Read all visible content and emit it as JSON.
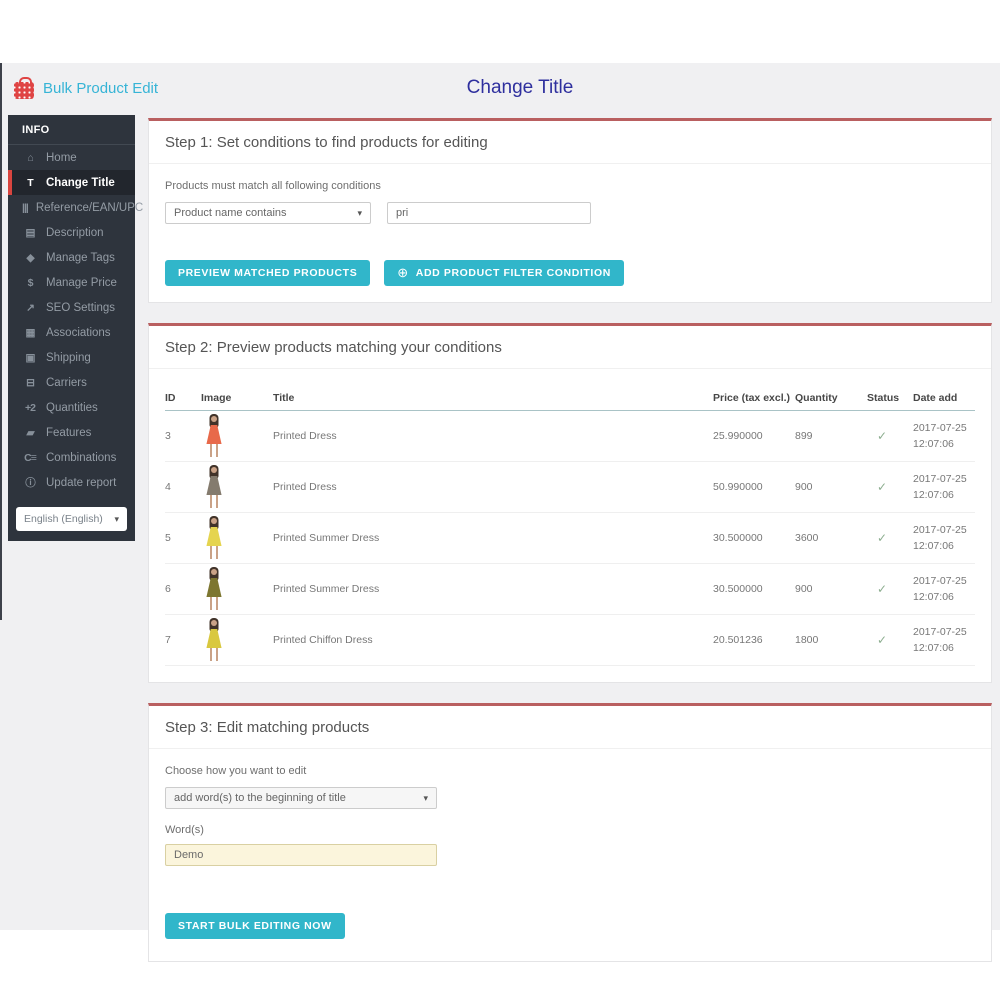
{
  "header": {
    "app_title": "Bulk Product Edit",
    "page_title": "Change Title"
  },
  "icons": {
    "caret": "▾",
    "plus": "⊕"
  },
  "sidebar": {
    "section_label": "INFO",
    "items": [
      {
        "label": "Home",
        "glyph": "⌂",
        "icon": "home-icon"
      },
      {
        "label": "Change Title",
        "glyph": "T",
        "icon": "title-icon"
      },
      {
        "label": "Reference/EAN/UPC",
        "glyph": "|||",
        "icon": "barcode-icon"
      },
      {
        "label": "Description",
        "glyph": "▤",
        "icon": "document-icon"
      },
      {
        "label": "Manage Tags",
        "glyph": "◆",
        "icon": "tag-icon"
      },
      {
        "label": "Manage Price",
        "glyph": "$",
        "icon": "dollar-icon"
      },
      {
        "label": "SEO Settings",
        "glyph": "↗",
        "icon": "trend-icon"
      },
      {
        "label": "Associations",
        "glyph": "▦",
        "icon": "grid-icon"
      },
      {
        "label": "Shipping",
        "glyph": "▣",
        "icon": "package-icon"
      },
      {
        "label": "Carriers",
        "glyph": "⊟",
        "icon": "truck-icon"
      },
      {
        "label": "Quantities",
        "glyph": "+2",
        "icon": "quantities-icon"
      },
      {
        "label": "Features",
        "glyph": "▰",
        "icon": "features-icon"
      },
      {
        "label": "Combinations",
        "glyph": "C≡",
        "icon": "combinations-icon"
      },
      {
        "label": "Update report",
        "glyph": "ⓘ",
        "icon": "report-icon"
      }
    ],
    "language_select": {
      "value": "English (English)"
    }
  },
  "step1": {
    "title": "Step 1: Set conditions to find products for editing",
    "condition_label": "Products must match all following conditions",
    "condition_select": "Product name contains",
    "condition_value": "pri",
    "preview_button": "PREVIEW MATCHED PRODUCTS",
    "add_filter_button": "ADD PRODUCT FILTER CONDITION"
  },
  "step2": {
    "title": "Step 2: Preview products matching your conditions",
    "columns": [
      "ID",
      "Image",
      "Title",
      "Price (tax excl.)",
      "Quantity",
      "Status",
      "Date add"
    ],
    "rows": [
      {
        "id": "3",
        "title": "Printed Dress",
        "price": "25.990000",
        "quantity": "899",
        "status": "✓",
        "date": "2017-07-25 12:07:06",
        "dress_color": "#e8694a"
      },
      {
        "id": "4",
        "title": "Printed Dress",
        "price": "50.990000",
        "quantity": "900",
        "status": "✓",
        "date": "2017-07-25 12:07:06",
        "dress_color": "#847b6e"
      },
      {
        "id": "5",
        "title": "Printed Summer Dress",
        "price": "30.500000",
        "quantity": "3600",
        "status": "✓",
        "date": "2017-07-25 12:07:06",
        "dress_color": "#e5d44f"
      },
      {
        "id": "6",
        "title": "Printed Summer Dress",
        "price": "30.500000",
        "quantity": "900",
        "status": "✓",
        "date": "2017-07-25 12:07:06",
        "dress_color": "#7d7630"
      },
      {
        "id": "7",
        "title": "Printed Chiffon Dress",
        "price": "20.501236",
        "quantity": "1800",
        "status": "✓",
        "date": "2017-07-25 12:07:06",
        "dress_color": "#d9c83f"
      }
    ]
  },
  "step3": {
    "title": "Step 3: Edit matching products",
    "choose_label": "Choose how you want to edit",
    "mode_select": "add word(s) to the beginning of title",
    "words_label": "Word(s)",
    "words_value": "Demo",
    "start_button": "START BULK EDITING NOW"
  },
  "colors": {
    "accent_cyan": "#31b6ca",
    "panel_border_red": "#b95f60",
    "active_item_red": "#d9453f",
    "brand_cyan": "#36b4d6",
    "page_title_navy": "#2e2f9e",
    "sidebar_bg": "#2e343d",
    "status_check_green": "#8dae90",
    "words_input_bg": "#fbf5dc"
  }
}
